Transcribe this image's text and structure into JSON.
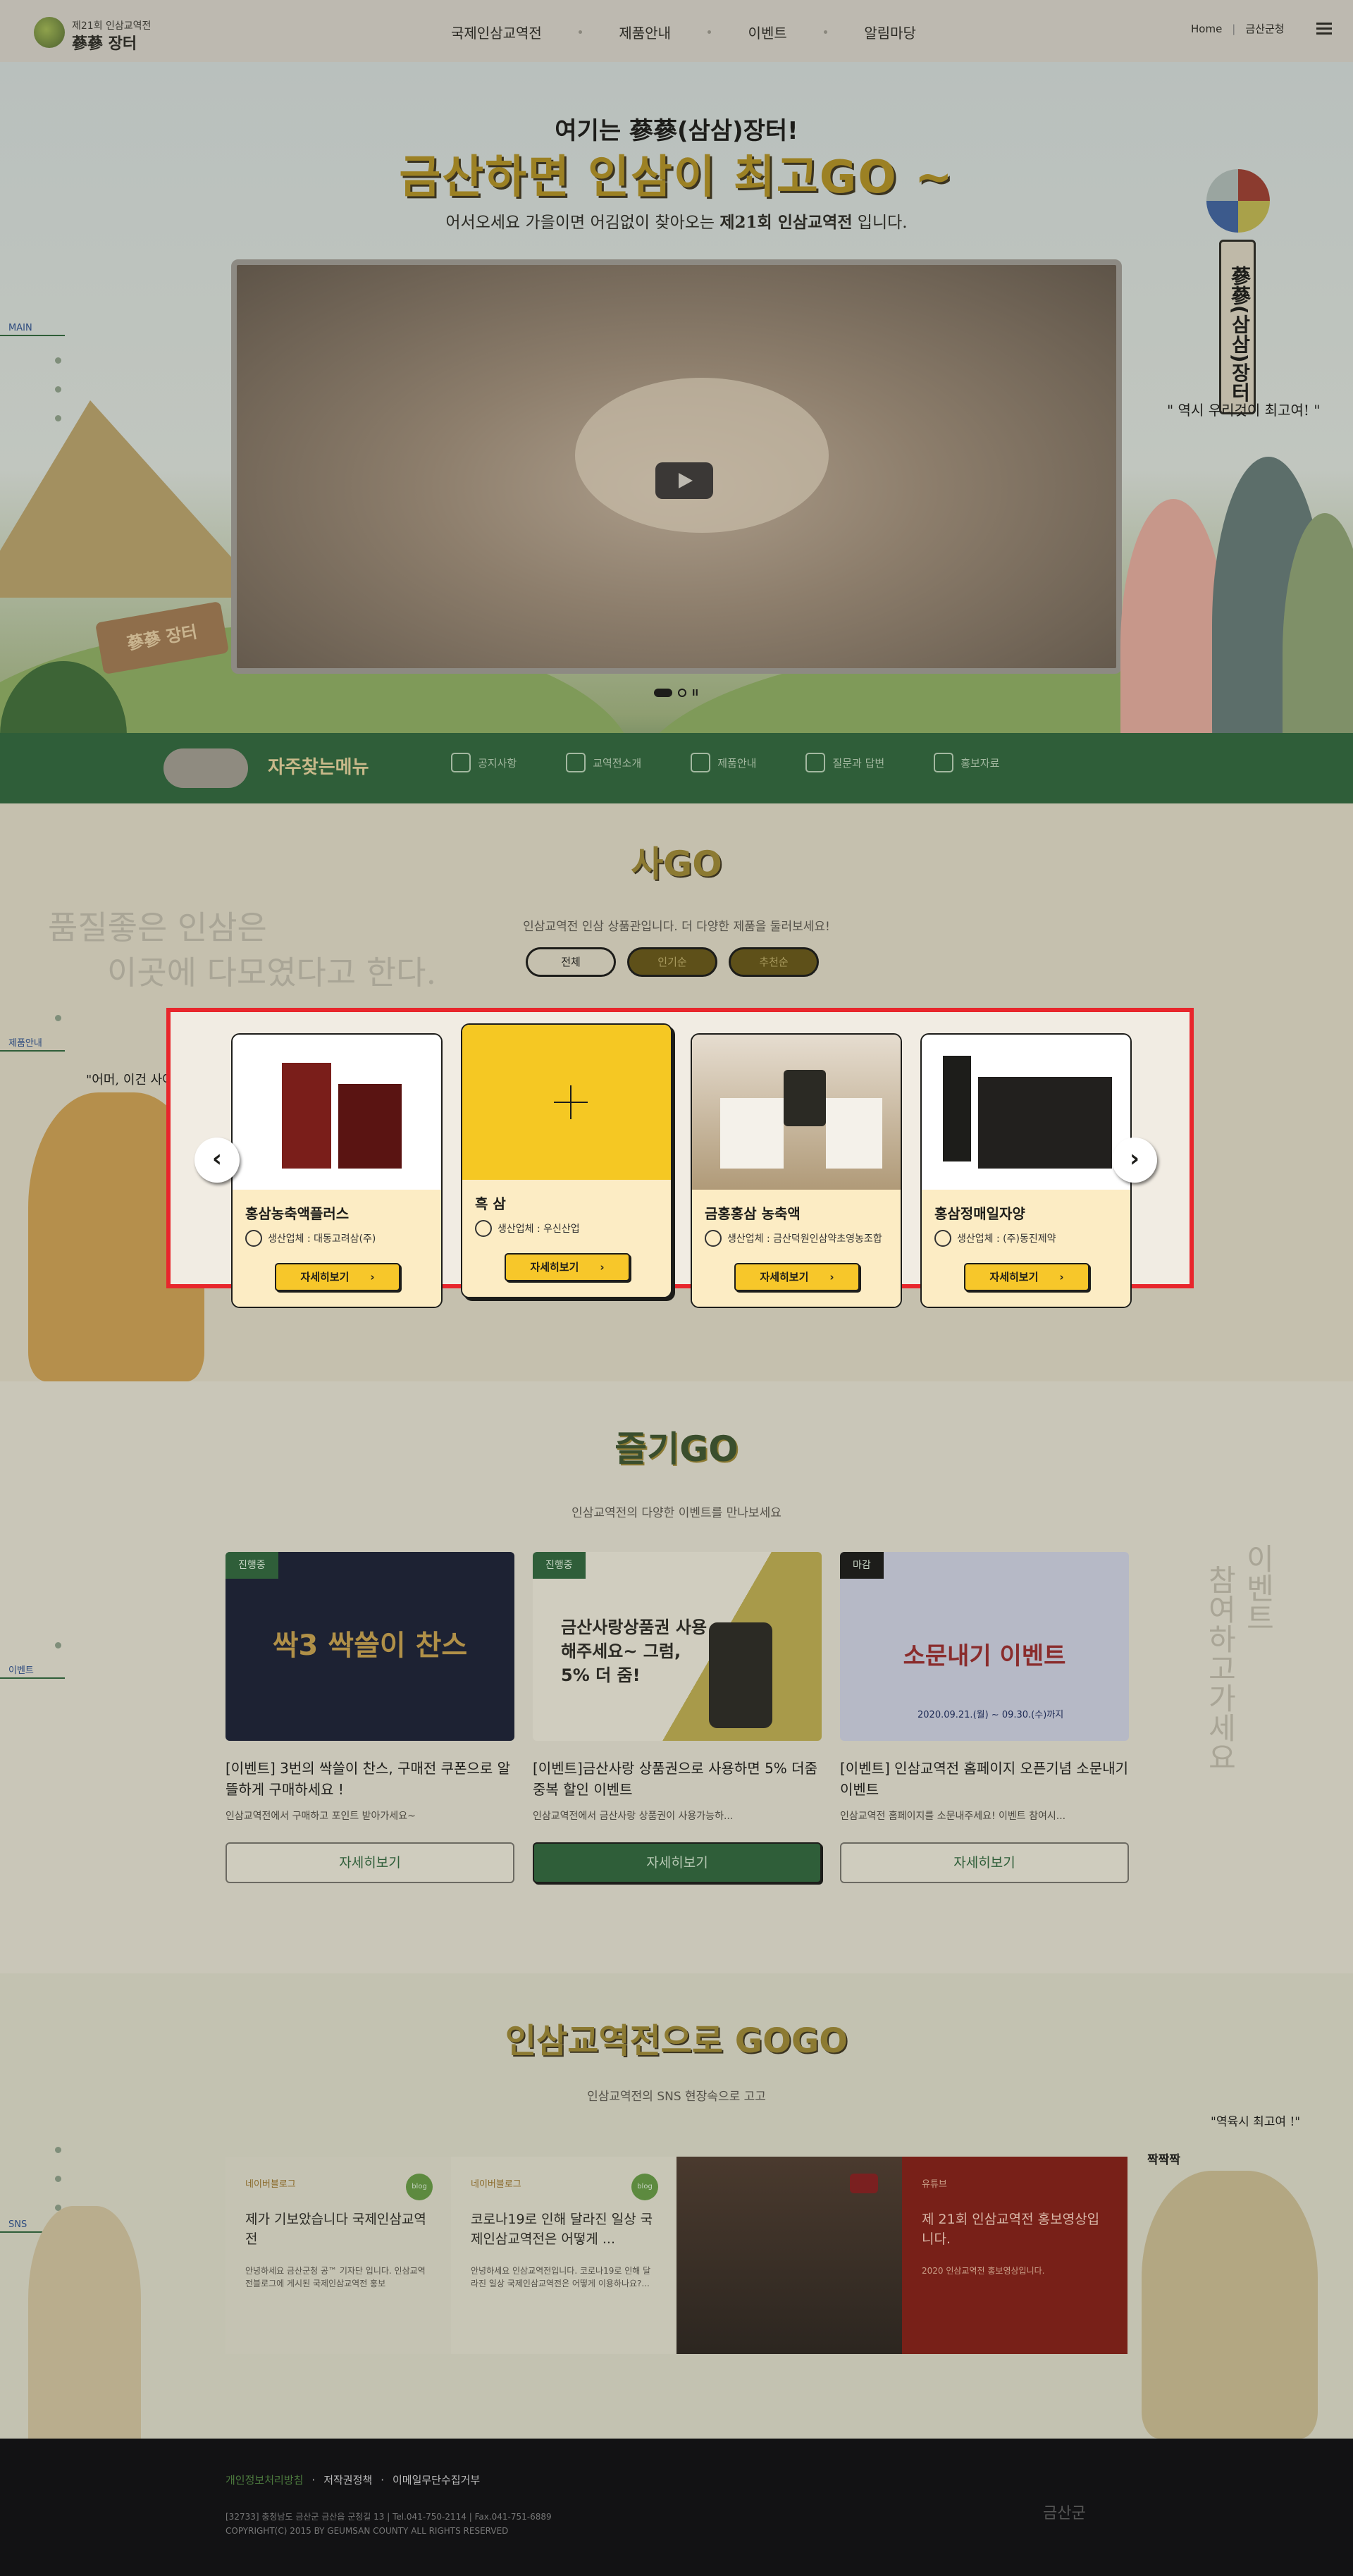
{
  "header": {
    "logo_sub": "제21회 인삼교역전",
    "logo_main": "蔘蔘 장터",
    "nav": [
      "국제인삼교역전",
      "제품안내",
      "이벤트",
      "알림마당"
    ],
    "util_home": "Home",
    "util_sep": "|",
    "util_county": "금산군청"
  },
  "hero": {
    "title1": "여기는 蔘蔘(삼삼)장터!",
    "title2": "금산하면 인삼이 최고GO ~",
    "sub_pre": "어서오세요 가을이면 어김없이 찾아오는 ",
    "sub_bold": "제21회 인삼교역전",
    "sub_post": " 입니다.",
    "quote": "\" 역시 우리것이 최고여! \"",
    "tag": "蔘蔘(삼삼)장터",
    "sign": "蔘蔘 장터",
    "side_label": "MAIN",
    "pause": "II"
  },
  "quick": {
    "title": "자주찾는메뉴",
    "items": [
      "공지사항",
      "교역전소개",
      "제품안내",
      "질문과 답변",
      "홍보자료"
    ]
  },
  "products": {
    "logo": "사GO",
    "sub": "인삼교역전 인삼 상품관입니다. 더 다양한 제품을 둘러보세요!",
    "tabs": [
      "전체",
      "인기순",
      "추천순"
    ],
    "bg_text1": "품질좋은 인삼은",
    "bg_text2": "이곳에 다모였다고 한다.",
    "side_label": "제품안내",
    "quote": "\"어머, 이건 사야해!\"",
    "prev": "‹",
    "next": "›",
    "items": [
      {
        "name": "홍삼농축액플러스",
        "maker": "생산업체 : 대동고려삼(주)",
        "btn": "자세히보기"
      },
      {
        "name": "흑 삼",
        "maker": "생산업체 : 우신산업",
        "btn": "자세히보기"
      },
      {
        "name": "금홍홍삼 농축액",
        "maker": "생산업체 : 금산덕원인삼약초영농조합",
        "btn": "자세히보기"
      },
      {
        "name": "홍삼정매일자양",
        "maker": "생산업체 : (주)동진제약",
        "btn": "자세히보기"
      }
    ]
  },
  "events": {
    "logo": "즐기GO",
    "sub": "인삼교역전의 다양한 이벤트를 만나보세요",
    "side_label": "이벤트",
    "vert1": "이벤트",
    "vert2": "참여하고가세요",
    "items": [
      {
        "badge": "진행중",
        "title": "[이벤트] 3번의 싹쓸이 찬스, 구매전 쿠폰으로 알뜰하게 구매하세요 !",
        "desc": "인삼교역전에서 구매하고 포인트 받아가세요~",
        "btn": "자세히보기",
        "img_text": "싹3 싹쓸이 찬스"
      },
      {
        "badge": "진행중",
        "title": "[이벤트]금산사랑 상품권으로 사용하면 5% 더줌 중복 할인 이벤트",
        "desc": "인삼교역전에서 금산사랑 상품권이 사용가능하...",
        "btn": "자세히보기",
        "img_text": "금산사랑상품권 사용해주세요~ 그럼, 5% 더 줌!"
      },
      {
        "badge": "마감",
        "title": "[이벤트] 인삼교역전 홈페이지 오픈기념 소문내기 이벤트",
        "desc": "인삼교역전 홈페이지를 소문내주세요! 이벤트 참여시...",
        "btn": "자세히보기",
        "img_text": "소문내기 이벤트",
        "period": "2020.09.21.(월) ~ 09.30.(수)까지"
      }
    ]
  },
  "sns": {
    "logo": "인삼교역전으로 GOGO",
    "sub": "인삼교역전의 SNS 현장속으로 고고",
    "side_label": "SNS",
    "quote": "\"역육시 최고여 !\"",
    "clap": "짝짝짝",
    "items": [
      {
        "type": "네이버블로그",
        "badge": "blog",
        "title": "제가 기보았습니다 국제인삼교역전",
        "desc": "안녕하세요 금산군청 공™ 기자단 입니다. 인삼교역전블로그에 게시된 국제인삼교역전 홍보"
      },
      {
        "type": "네이버블로그",
        "badge": "blog",
        "title": "코로나19로 인해 달라진 일상 국제인삼교역전은 어떻게 ...",
        "desc": "안녕하세요 인삼교역전입니다. 코로나19로 인해 달라진 일상 국제인삼교역전은 어떻게 이용하나요?..."
      },
      {
        "type": "유튜브",
        "title": "제 21회 인삼교역전 홍보영상입니다.",
        "desc": "2020 인삼교역전 홍보영상입니다."
      }
    ]
  },
  "footer": {
    "links": [
      "개인정보처리방침",
      "저작권정책",
      "이메일무단수집거부"
    ],
    "address": "[32733] 충청남도 금산군 금산읍 군청길 13  |  Tel.041-750-2114  |  Fax.041-751-6889",
    "copyright": "COPYRIGHT(C) 2015 BY GEUMSAN COUNTY ALL RIGHTS RESERVED",
    "logo": "금산군"
  },
  "colors": {
    "highlight": "#e8262c",
    "brand_green": "#2f5e39",
    "button_yellow": "#f7c72a"
  }
}
